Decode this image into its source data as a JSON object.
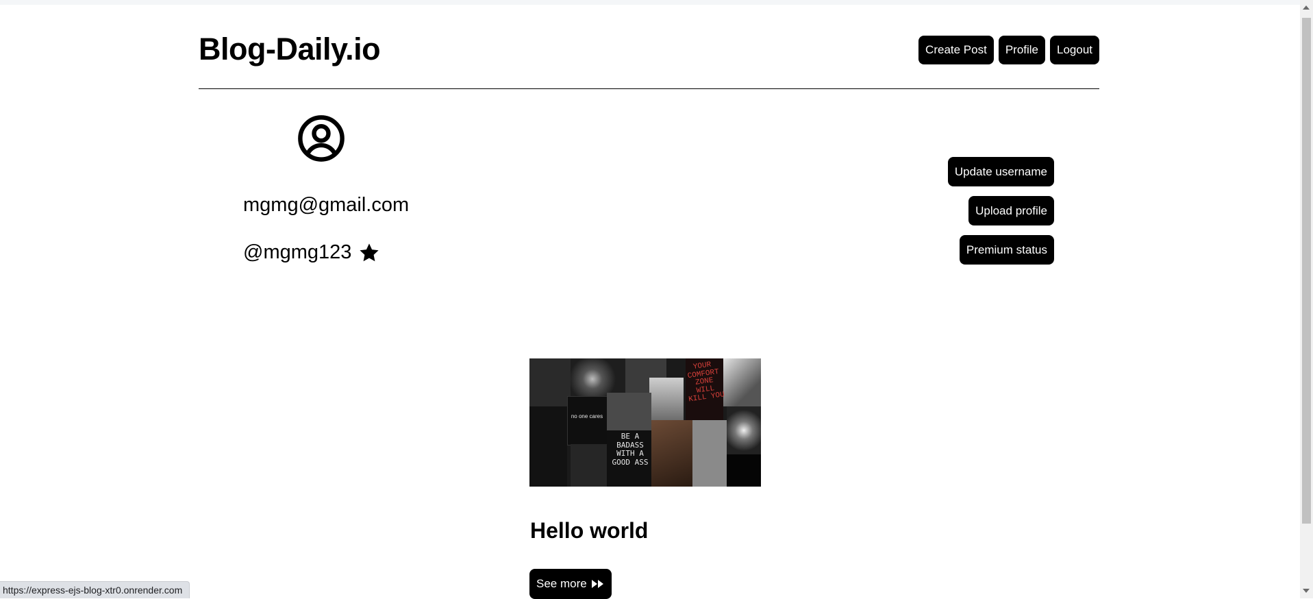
{
  "header": {
    "brand": "Blog-Daily.io",
    "nav": {
      "create_post": "Create Post",
      "profile": "Profile",
      "logout": "Logout"
    }
  },
  "profile": {
    "avatar_icon": "user-circle-icon",
    "email": "mgmg@gmail.com",
    "username": "@mgmg123",
    "premium_icon": "star-icon"
  },
  "actions": {
    "update_username": "Update username",
    "upload_profile": "Upload profile",
    "premium_status": "Premium status"
  },
  "posts": [
    {
      "title": "Hello world",
      "image_texts": {
        "card": "no one cares",
        "collage": "BE A BADASS WITH A GOOD ASS",
        "neon": "YOUR COMFORT ZONE WILL KILL YOU"
      },
      "see_more_label": "See more",
      "see_more_icon": "fast-forward-icon"
    }
  ],
  "status_bar": {
    "url": "https://express-ejs-blog-xtr0.onrender.com"
  },
  "colors": {
    "button_bg": "#000000",
    "button_text": "#ffffff",
    "page_bg": "#ffffff"
  }
}
